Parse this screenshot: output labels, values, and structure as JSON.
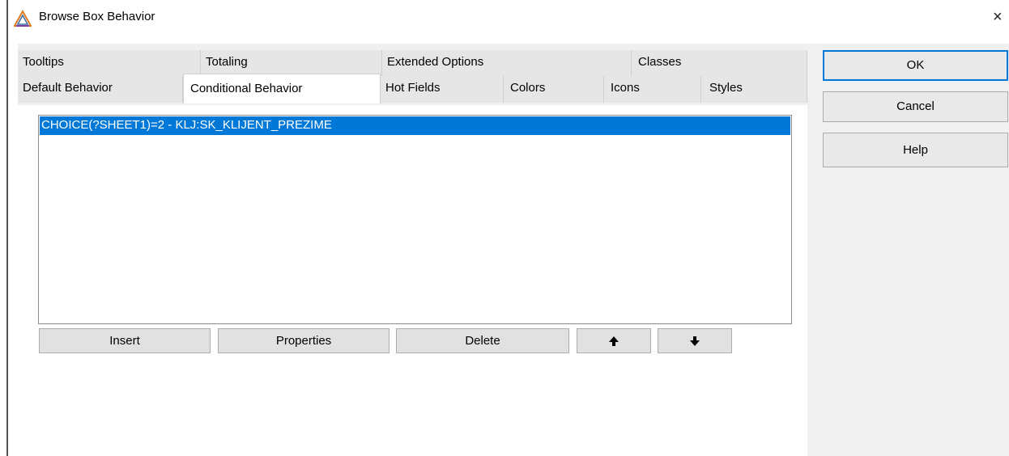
{
  "window": {
    "title": "Browse Box Behavior",
    "close_glyph": "×",
    "icon": "clarion-app-icon"
  },
  "tabs": {
    "back_row": [
      {
        "label": "Tooltips"
      },
      {
        "label": "Totaling"
      },
      {
        "label": "Extended Options"
      },
      {
        "label": "Classes"
      }
    ],
    "front_row": [
      {
        "label": "Default Behavior"
      },
      {
        "label": "Conditional Behavior",
        "selected": true
      },
      {
        "label": "Hot Fields"
      },
      {
        "label": "Colors"
      },
      {
        "label": "Icons"
      },
      {
        "label": "Styles"
      }
    ]
  },
  "list": {
    "items": [
      {
        "text": "CHOICE(?SHEET1)=2 - KLJ:SK_KLIJENT_PREZIME",
        "selected": true
      }
    ]
  },
  "list_buttons": {
    "insert": "Insert",
    "properties": "Properties",
    "delete": "Delete",
    "move_up": "🡅",
    "move_down": "🡇"
  },
  "side_buttons": {
    "ok": "OK",
    "cancel": "Cancel",
    "help": "Help"
  },
  "colors": {
    "selection": "#0078d7",
    "dialog_bg": "#f0f0f0"
  }
}
